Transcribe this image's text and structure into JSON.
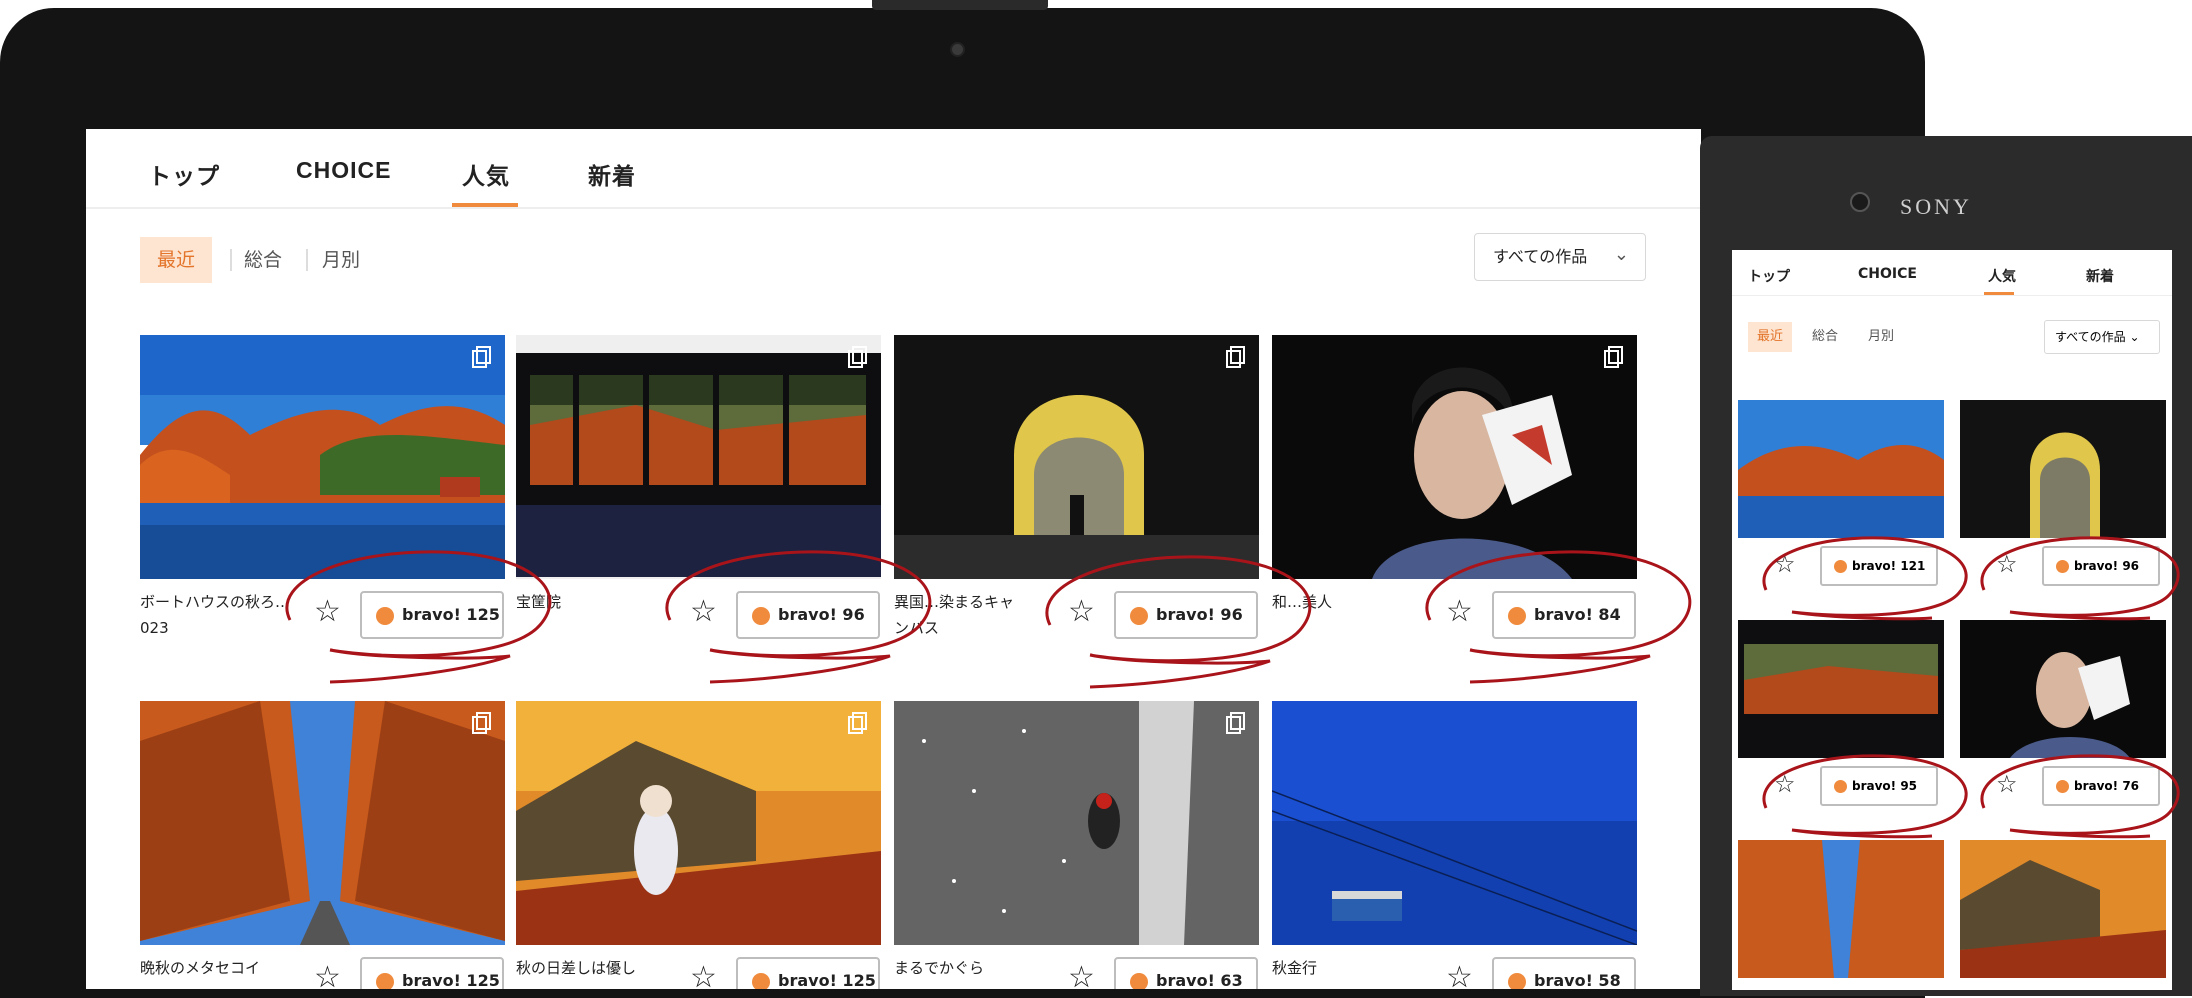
{
  "nav": {
    "tabs": [
      "トップ",
      "CHOICE",
      "人気",
      "新着"
    ],
    "active_tab": "人気"
  },
  "subnav": {
    "items": [
      "最近",
      "総合",
      "月別"
    ],
    "active": "最近",
    "filter_label": "すべての作品"
  },
  "gallery": [
    {
      "title": "ボートハウスの秋ろ…",
      "title2": "023",
      "bravo": "bravo! 125"
    },
    {
      "title": "宝筐院",
      "title2": "",
      "bravo": "bravo! 96"
    },
    {
      "title": "異国…染まるキャ",
      "title2": "ンパス",
      "bravo": "bravo! 96"
    },
    {
      "title": "和…美人",
      "title2": "",
      "bravo": "bravo! 84"
    },
    {
      "title": "晩秋のメタセコイ",
      "title2": "",
      "bravo": "bravo! 125"
    },
    {
      "title": "秋の日差しは優し",
      "title2": "",
      "bravo": "bravo! 125"
    },
    {
      "title": "まるでかぐら",
      "title2": "",
      "bravo": "bravo! 63"
    },
    {
      "title": "秋金行",
      "title2": "",
      "bravo": "bravo! 58"
    }
  ],
  "phone": {
    "brand": "SONY",
    "bravos": [
      "bravo! 121",
      "bravo! 96",
      "bravo! 95",
      "bravo! 76"
    ]
  },
  "colors": {
    "accent": "#f08a3c",
    "accent_bg": "#fde5d2",
    "annotation": "#a8141a"
  }
}
